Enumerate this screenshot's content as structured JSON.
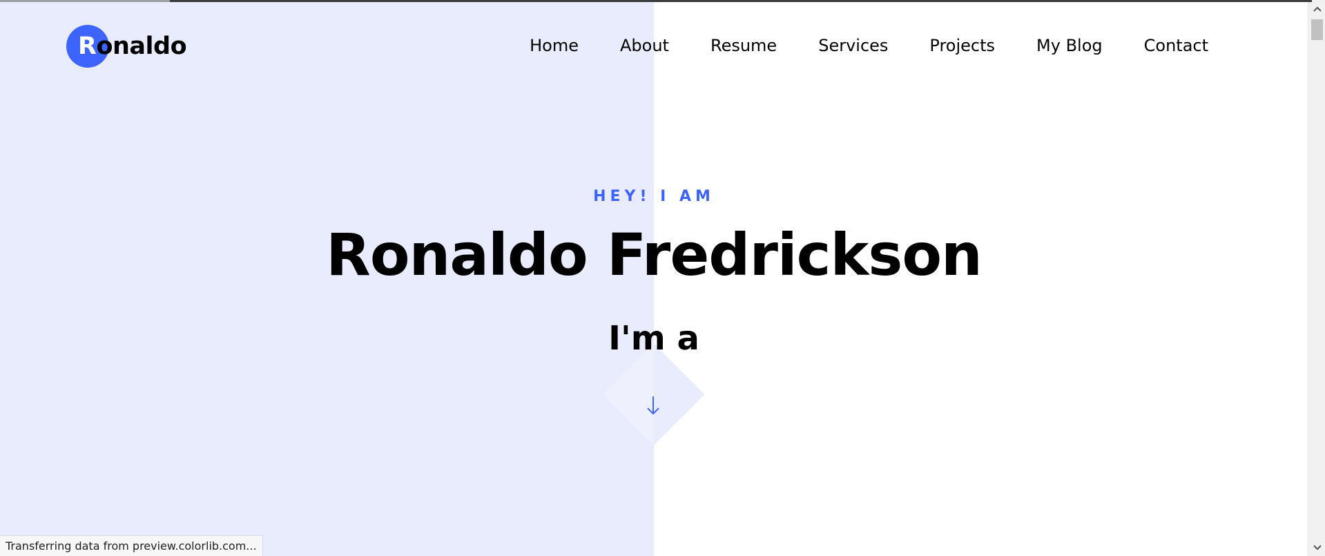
{
  "header": {
    "logo_first_letter": "R",
    "logo_rest": "onaldo"
  },
  "nav": {
    "items": [
      {
        "label": "Home"
      },
      {
        "label": "About"
      },
      {
        "label": "Resume"
      },
      {
        "label": "Services"
      },
      {
        "label": "Projects"
      },
      {
        "label": "My Blog"
      },
      {
        "label": "Contact"
      }
    ]
  },
  "hero": {
    "subtitle": "HEY! I AM",
    "name": "Ronaldo Fredrickson",
    "role_prefix": "I'm a"
  },
  "scroll": {
    "arrow_icon": "arrow-down-icon"
  },
  "browser": {
    "status_text": "Transferring data from preview.colorlib.com..."
  },
  "colors": {
    "accent": "#3e64ff",
    "left_panel_bg": "#e9ecfd",
    "right_panel_bg": "#ffffff",
    "text": "#000000"
  }
}
